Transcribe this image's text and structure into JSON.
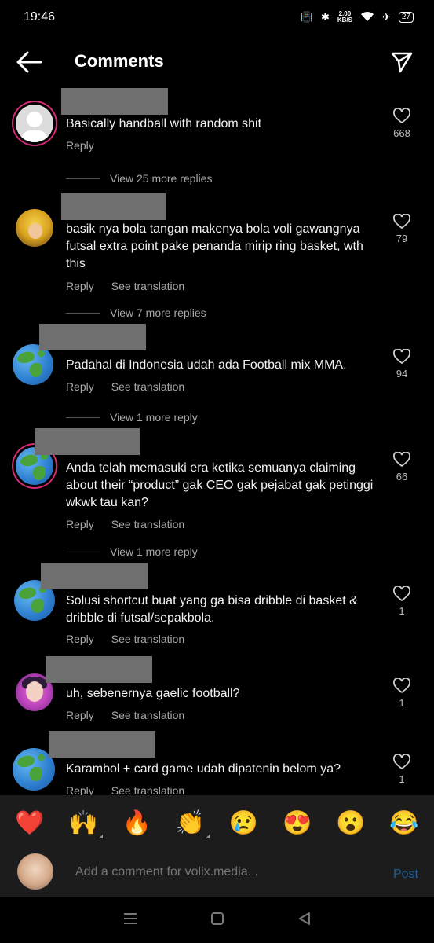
{
  "status_bar": {
    "time": "19:46",
    "speed_value": "2.00",
    "speed_unit": "KB/S",
    "battery": "27"
  },
  "header": {
    "title": "Comments"
  },
  "comments": [
    {
      "text": "Basically handball with random shit",
      "reply_label": "Reply",
      "translate_label": "",
      "likes": "668",
      "avatar": "default"
    },
    {
      "text": "basik nya bola tangan makenya bola voli gawangnya futsal extra point pake penanda mirip ring basket, wth this",
      "reply_label": "Reply",
      "translate_label": "See translation",
      "likes": "79",
      "avatar": "anime"
    },
    {
      "text": "Padahal di Indonesia udah ada Football mix MMA.",
      "reply_label": "Reply",
      "translate_label": "See translation",
      "likes": "94",
      "avatar": "earth"
    },
    {
      "text": "Anda telah memasuki era ketika semuanya claiming about their “product” gak CEO gak pejabat gak petinggi wkwk tau kan?",
      "reply_label": "Reply",
      "translate_label": "See translation",
      "likes": "66",
      "avatar": "earth"
    },
    {
      "text": "Solusi shortcut buat yang ga bisa dribble di basket & dribble di futsal/sepakbola.",
      "reply_label": "Reply",
      "translate_label": "See translation",
      "likes": "1",
      "avatar": "earth"
    },
    {
      "text": "uh, sebenernya gaelic football?",
      "reply_label": "Reply",
      "translate_label": "See translation",
      "likes": "1",
      "avatar": "pinkgirl"
    },
    {
      "text": "Karambol + card game udah dipatenin belom ya?",
      "reply_label": "Reply",
      "translate_label": "See translation",
      "likes": "1",
      "avatar": "earth"
    }
  ],
  "more_replies": [
    "View 25 more replies",
    "View 7 more replies",
    "View 1 more reply",
    "View 1 more reply"
  ],
  "reactions": [
    {
      "emoji": "❤️",
      "name": "red-heart"
    },
    {
      "emoji": "🙌",
      "name": "raising-hands"
    },
    {
      "emoji": "🔥",
      "name": "fire"
    },
    {
      "emoji": "👏",
      "name": "clapping-hands"
    },
    {
      "emoji": "😢",
      "name": "crying-face"
    },
    {
      "emoji": "😍",
      "name": "heart-eyes"
    },
    {
      "emoji": "😮",
      "name": "open-mouth"
    },
    {
      "emoji": "😂",
      "name": "tears-of-joy"
    }
  ],
  "comment_bar": {
    "placeholder": "Add a comment for volix.media...",
    "post_label": "Post"
  },
  "colors": {
    "background": "#000000",
    "post_disabled": "#1f5f99",
    "meta_text": "#a8a8a8",
    "username_mask": "#6f6f6f"
  }
}
